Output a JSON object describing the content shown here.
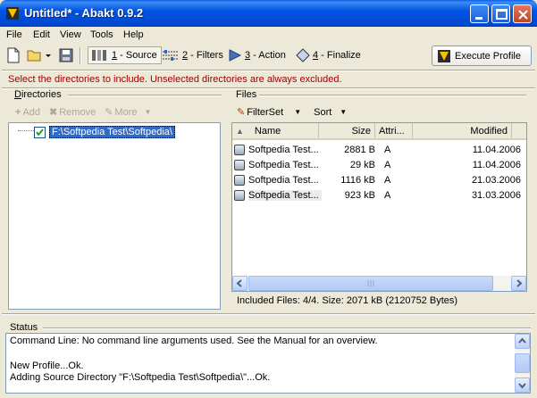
{
  "window": {
    "title": "Untitled* - Abakt 0.9.2"
  },
  "menu": [
    "File",
    "Edit",
    "View",
    "Tools",
    "Help"
  ],
  "toolbar": {
    "steps": [
      {
        "num": "1",
        "label": " - Source"
      },
      {
        "num": "2",
        "label": " - Filters"
      },
      {
        "num": "3",
        "label": " - Action"
      },
      {
        "num": "4",
        "label": " - Finalize"
      }
    ],
    "execute_label": "Execute Profile"
  },
  "info_message": "Select the directories to include. Unselected directories are always excluded.",
  "directories": {
    "label": "Directories",
    "buttons": {
      "add": "Add",
      "remove": "Remove",
      "more": "More"
    },
    "tree_item": "F:\\Softpedia Test\\Softpedia\\"
  },
  "files": {
    "label": "Files",
    "filterset_label": "FilterSet",
    "sort_label": "Sort",
    "columns": [
      "Name",
      "Size",
      "Attri...",
      "Modified"
    ],
    "rows": [
      {
        "name": "Softpedia Test...",
        "size": "2881 B",
        "attr": "A",
        "modified": "11.04.2006"
      },
      {
        "name": "Softpedia Test...",
        "size": "29 kB",
        "attr": "A",
        "modified": "11.04.2006"
      },
      {
        "name": "Softpedia Test...",
        "size": "1116 kB",
        "attr": "A",
        "modified": "21.03.2006"
      },
      {
        "name": "Softpedia Test...",
        "size": "923 kB",
        "attr": "A",
        "modified": "31.03.2006"
      }
    ],
    "status": "Included Files: 4/4. Size: 2071 kB (2120752 Bytes)"
  },
  "status": {
    "label": "Status",
    "lines": [
      "Command Line: No command line arguments used. See the Manual for an overview.",
      "",
      "New Profile...Ok.",
      "Adding Source Directory \"F:\\Softpedia Test\\Softpedia\\\"...Ok."
    ]
  },
  "colors": {
    "titlebar": "#0054e3",
    "info_text": "#a00000",
    "selection": "#316ac5"
  }
}
